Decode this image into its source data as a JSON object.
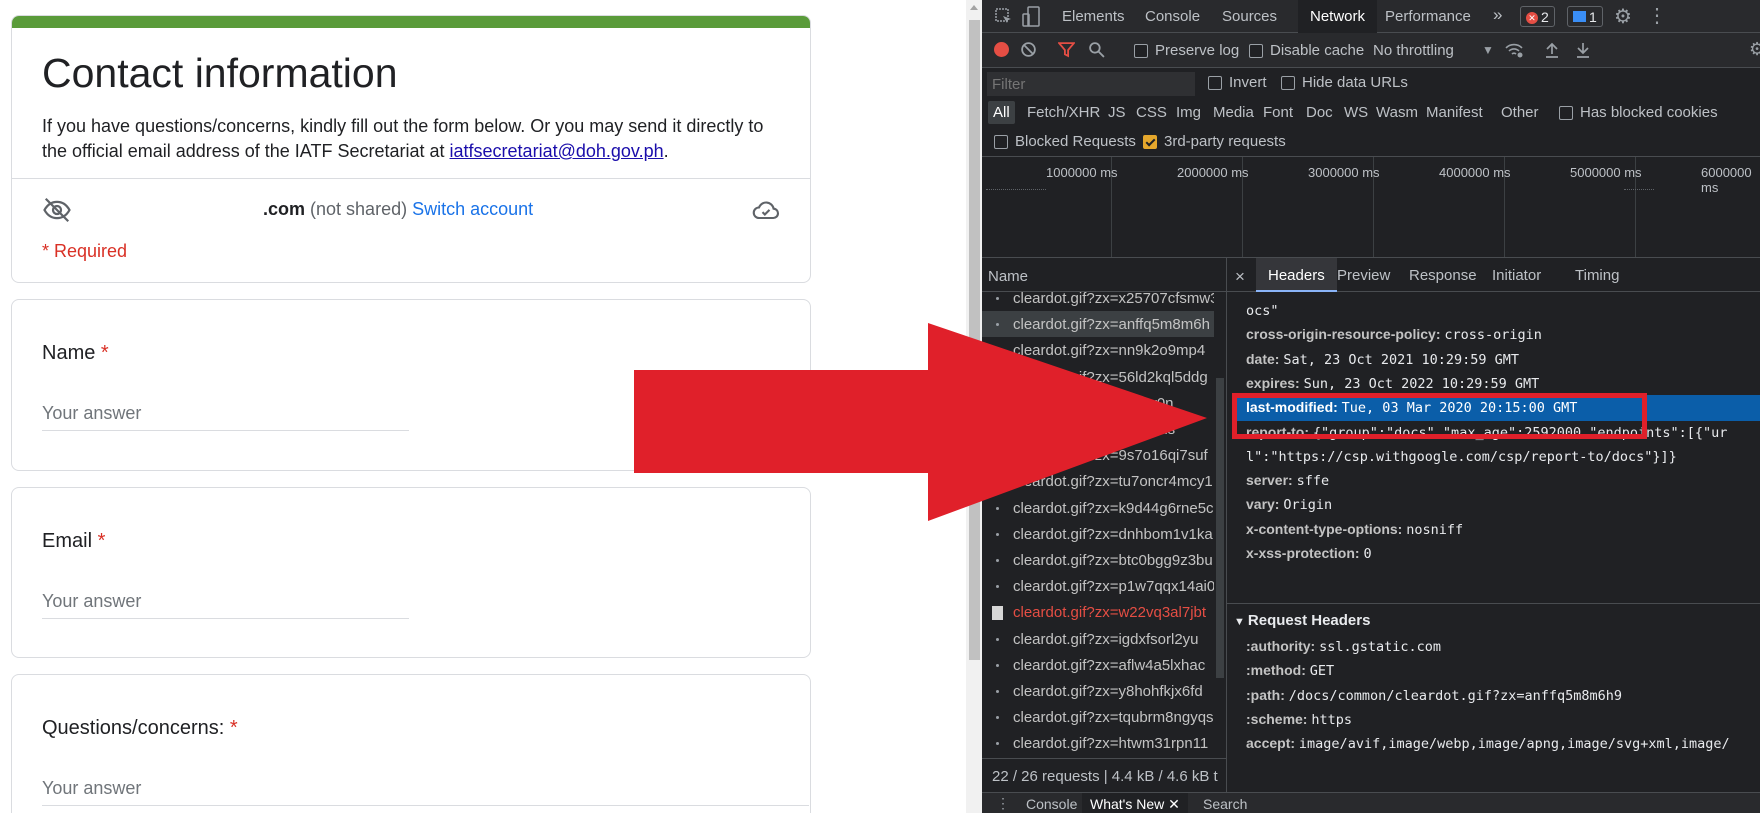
{
  "form": {
    "title": "Contact information",
    "description": "If you have questions/concerns, kindly fill out the form below. Or you may send it directly to the official email address of the IATF Secretariat at ",
    "email_link": "iatfsecretariat@doh.gov.ph",
    "desc_end": ".",
    "account_email": ".com",
    "not_shared": "(not shared)",
    "switch_account": "Switch account",
    "required_note": "* Required",
    "questions": [
      {
        "label": "Name",
        "required": "*",
        "placeholder": "Your answer"
      },
      {
        "label": "Email",
        "required": "*",
        "placeholder": "Your answer"
      },
      {
        "label": "Questions/concerns:",
        "required": "*",
        "placeholder": "Your answer"
      }
    ]
  },
  "devtools": {
    "tabs": [
      "Elements",
      "Console",
      "Sources",
      "Network",
      "Performance"
    ],
    "active_tab": "Network",
    "more": "»",
    "error_count": "2",
    "message_count": "1",
    "toolbar": {
      "preserve_log": "Preserve log",
      "disable_cache": "Disable cache",
      "throttling": "No throttling"
    },
    "filter": {
      "placeholder": "Filter",
      "invert": "Invert",
      "hide_data_urls": "Hide data URLs",
      "types": [
        "All",
        "Fetch/XHR",
        "JS",
        "CSS",
        "Img",
        "Media",
        "Font",
        "Doc",
        "WS",
        "Wasm",
        "Manifest",
        "Other"
      ],
      "has_blocked_cookies": "Has blocked cookies",
      "blocked_requests": "Blocked Requests",
      "third_party": "3rd-party requests"
    },
    "timeline_labels": [
      "1000000 ms",
      "2000000 ms",
      "3000000 ms",
      "4000000 ms",
      "5000000 ms",
      "6000000 ms"
    ],
    "name_header": "Name",
    "requests": [
      "cleardot.gif?zx=x25707cfsmw3",
      "cleardot.gif?zx=anffq5m8m6h",
      "cleardot.gif?zx=nn9k2o9mp4",
      "cleardot.gif?zx=56ld2kql5ddg",
      "cleardot.gif?zx=gsl3w0n",
      "cleardot.gif?zx=r5dwuds",
      "cleardot.gif?zx=9s7o16qi7suf",
      "cleardot.gif?zx=tu7oncr4mcy1",
      "cleardot.gif?zx=k9d44g6rne5c",
      "cleardot.gif?zx=dnhbom1v1ka",
      "cleardot.gif?zx=btc0bgg9z3bu",
      "cleardot.gif?zx=p1w7qqx14ai0",
      "cleardot.gif?zx=w22vq3al7jbt",
      "cleardot.gif?zx=igdxfsorl2yu",
      "cleardot.gif?zx=aflw4a5lxhac",
      "cleardot.gif?zx=y8hohfkjx6fd",
      "cleardot.gif?zx=tqubrm8ngyqs",
      "cleardot.gif?zx=htwm31rpn11"
    ],
    "status": "22 / 26 requests | 4.4 kB / 4.6 kB t",
    "detail_tabs": [
      "Headers",
      "Preview",
      "Response",
      "Initiator",
      "Timing"
    ],
    "close": "×",
    "response_headers": [
      {
        "k": "",
        "v": "ocs\""
      },
      {
        "k": "cross-origin-resource-policy:",
        "v": "cross-origin"
      },
      {
        "k": "date:",
        "v": "Sat, 23 Oct 2021 10:29:59 GMT"
      },
      {
        "k": "expires:",
        "v": "Sun, 23 Oct 2022 10:29:59 GMT"
      },
      {
        "k": "last-modified:",
        "v": "Tue, 03 Mar 2020 20:15:00 GMT"
      },
      {
        "k": "report-to:",
        "v": "{\"group\":\"docs\",\"max_age\":2592000,\"endpoints\":[{\"ur"
      },
      {
        "k": "",
        "v": "l\":\"https://csp.withgoogle.com/csp/report-to/docs\"}]}"
      },
      {
        "k": "server:",
        "v": "sffe"
      },
      {
        "k": "vary:",
        "v": "Origin"
      },
      {
        "k": "x-content-type-options:",
        "v": "nosniff"
      },
      {
        "k": "x-xss-protection:",
        "v": "0"
      }
    ],
    "request_headers_title": "Request Headers",
    "request_headers": [
      {
        "k": ":authority:",
        "v": "ssl.gstatic.com"
      },
      {
        "k": ":method:",
        "v": "GET"
      },
      {
        "k": ":path:",
        "v": "/docs/common/cleardot.gif?zx=anffq5m8m6h9"
      },
      {
        "k": ":scheme:",
        "v": "https"
      },
      {
        "k": "accept:",
        "v": "image/avif,image/webp,image/apng,image/svg+xml,image/"
      }
    ],
    "drawer_tabs": [
      "Console",
      "What's New",
      "Search"
    ]
  },
  "colors": {
    "form_accent": "#5a9b3a",
    "required_red": "#d93025",
    "link_blue": "#1a73e8",
    "selected_row": "#0b5ea9",
    "annotation_red": "#e0202a"
  }
}
